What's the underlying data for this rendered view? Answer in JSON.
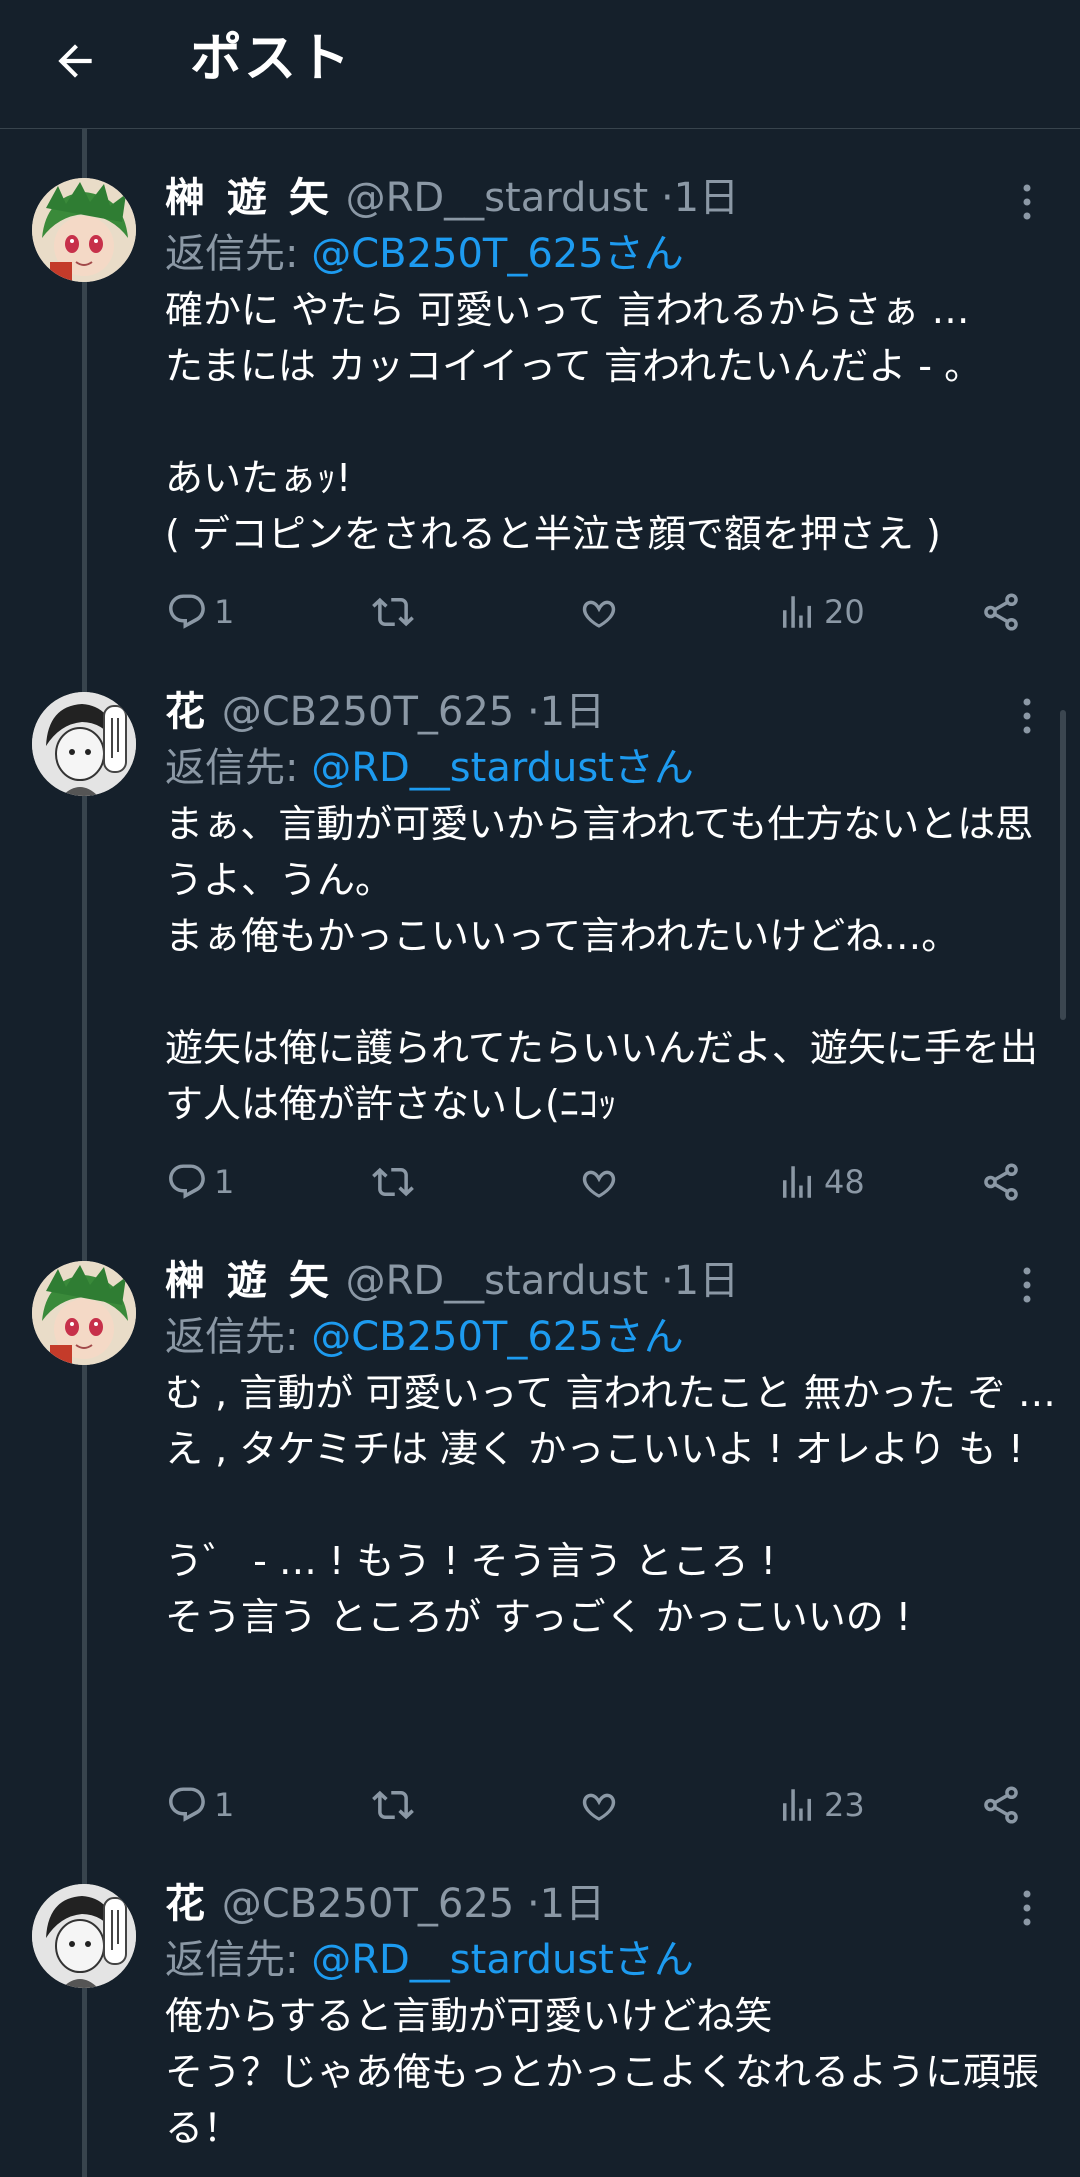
{
  "header": {
    "title": "ポスト"
  },
  "tweets": [
    {
      "name": "榊 遊 矢",
      "handle": "@RD__stardust",
      "time": "1日",
      "reply_prefix": "返信先:",
      "reply_target": "@CB250T_625さん",
      "text": "確かに やたら 可愛いって 言われるからさぁ …\nたまには カッコイイって 言われたいんだよ - 。\n\nあいたぁｯ!\n( デコピンをされると半泣き顔で額を押さえ )",
      "replies": "1",
      "views": "20",
      "avatar": "green-haired-character"
    },
    {
      "name": "花",
      "handle": "@CB250T_625",
      "time": "1日",
      "reply_prefix": "返信先:",
      "reply_target": "@RD__stardustさん",
      "text": "まぁ、言動が可愛いから言われても仕方ないとは思うよ、うん。\nまぁ俺もかっこいいって言われたいけどね…。\n\n遊矢は俺に護られてたらいいんだよ、遊矢に手を出す人は俺が許さないし(ﾆｺｯ",
      "replies": "1",
      "views": "48",
      "avatar": "manga-character"
    },
    {
      "name": "榊 遊 矢",
      "handle": "@RD__stardust",
      "time": "1日",
      "reply_prefix": "返信先:",
      "reply_target": "@CB250T_625さん",
      "text": "む , 言動が 可愛いって 言われたこと 無かった ぞ …\nえ , タケミチは 凄く かっこいいよ ! オレより も !\n\nう゛ - … ! もう ! そう言う ところ !\nそう言う ところが すっごく かっこいいの !",
      "replies": "1",
      "views": "23",
      "avatar": "green-haired-character"
    },
    {
      "name": "花",
      "handle": "@CB250T_625",
      "time": "1日",
      "reply_prefix": "返信先:",
      "reply_target": "@RD__stardustさん",
      "text": "俺からすると言動が可愛いけどね笑\nそう？じゃあ俺もっとかっこよくなれるように頑張る！",
      "avatar": "manga-character"
    }
  ],
  "colors": {
    "background": "#15202b",
    "muted": "#8b98a5",
    "accent": "#1d9bf0",
    "divider": "#38444d"
  },
  "icons": [
    "back-arrow-icon",
    "more-icon",
    "reply-icon",
    "retweet-icon",
    "like-icon",
    "views-icon",
    "share-icon"
  ]
}
